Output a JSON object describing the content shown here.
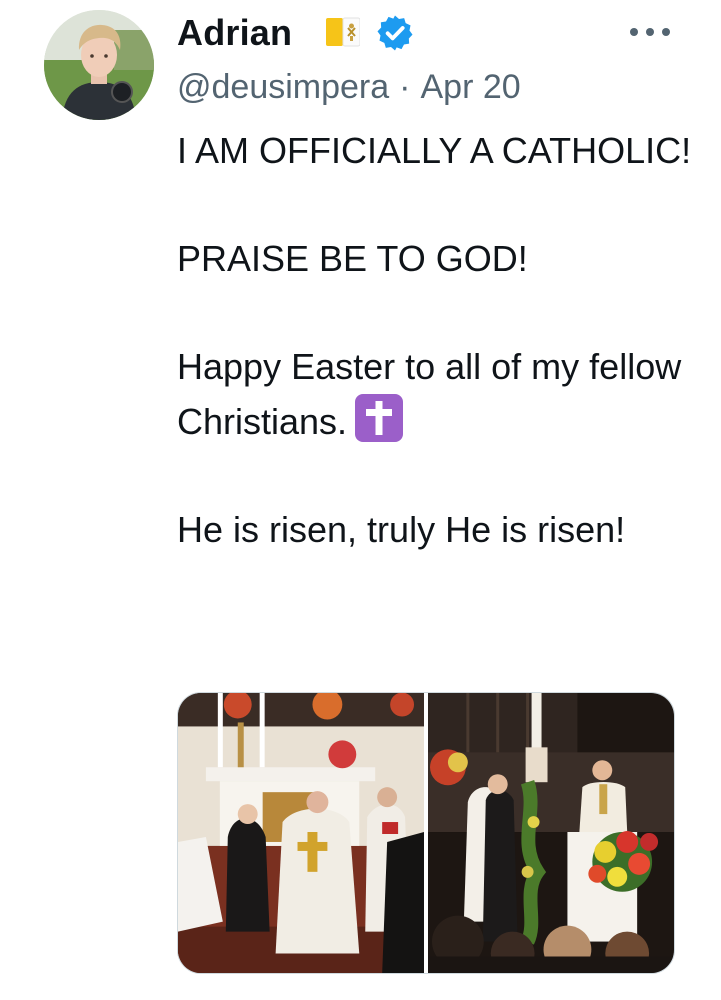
{
  "author": {
    "name": "Adrian",
    "handle": "@deusimpera",
    "separator": "·",
    "date": "Apr 20",
    "badges": [
      "vatican-flag-icon",
      "verified-icon"
    ]
  },
  "tweet": {
    "paragraphs": [
      "I AM OFFICIALLY A CATHOLIC!",
      "PRAISE BE TO GOD!",
      "Happy Easter to all of my fellow Christians.",
      "He is risen, truly He is risen!"
    ],
    "emoji": "latin-cross-emoji"
  },
  "media": {
    "count": 2,
    "items": [
      "altar-photo",
      "ceremony-photo"
    ]
  },
  "colors": {
    "text": "#0f1419",
    "secondary": "#536471",
    "verified": "#1d9bf0",
    "emoji_purple": "#9b5fc9"
  }
}
